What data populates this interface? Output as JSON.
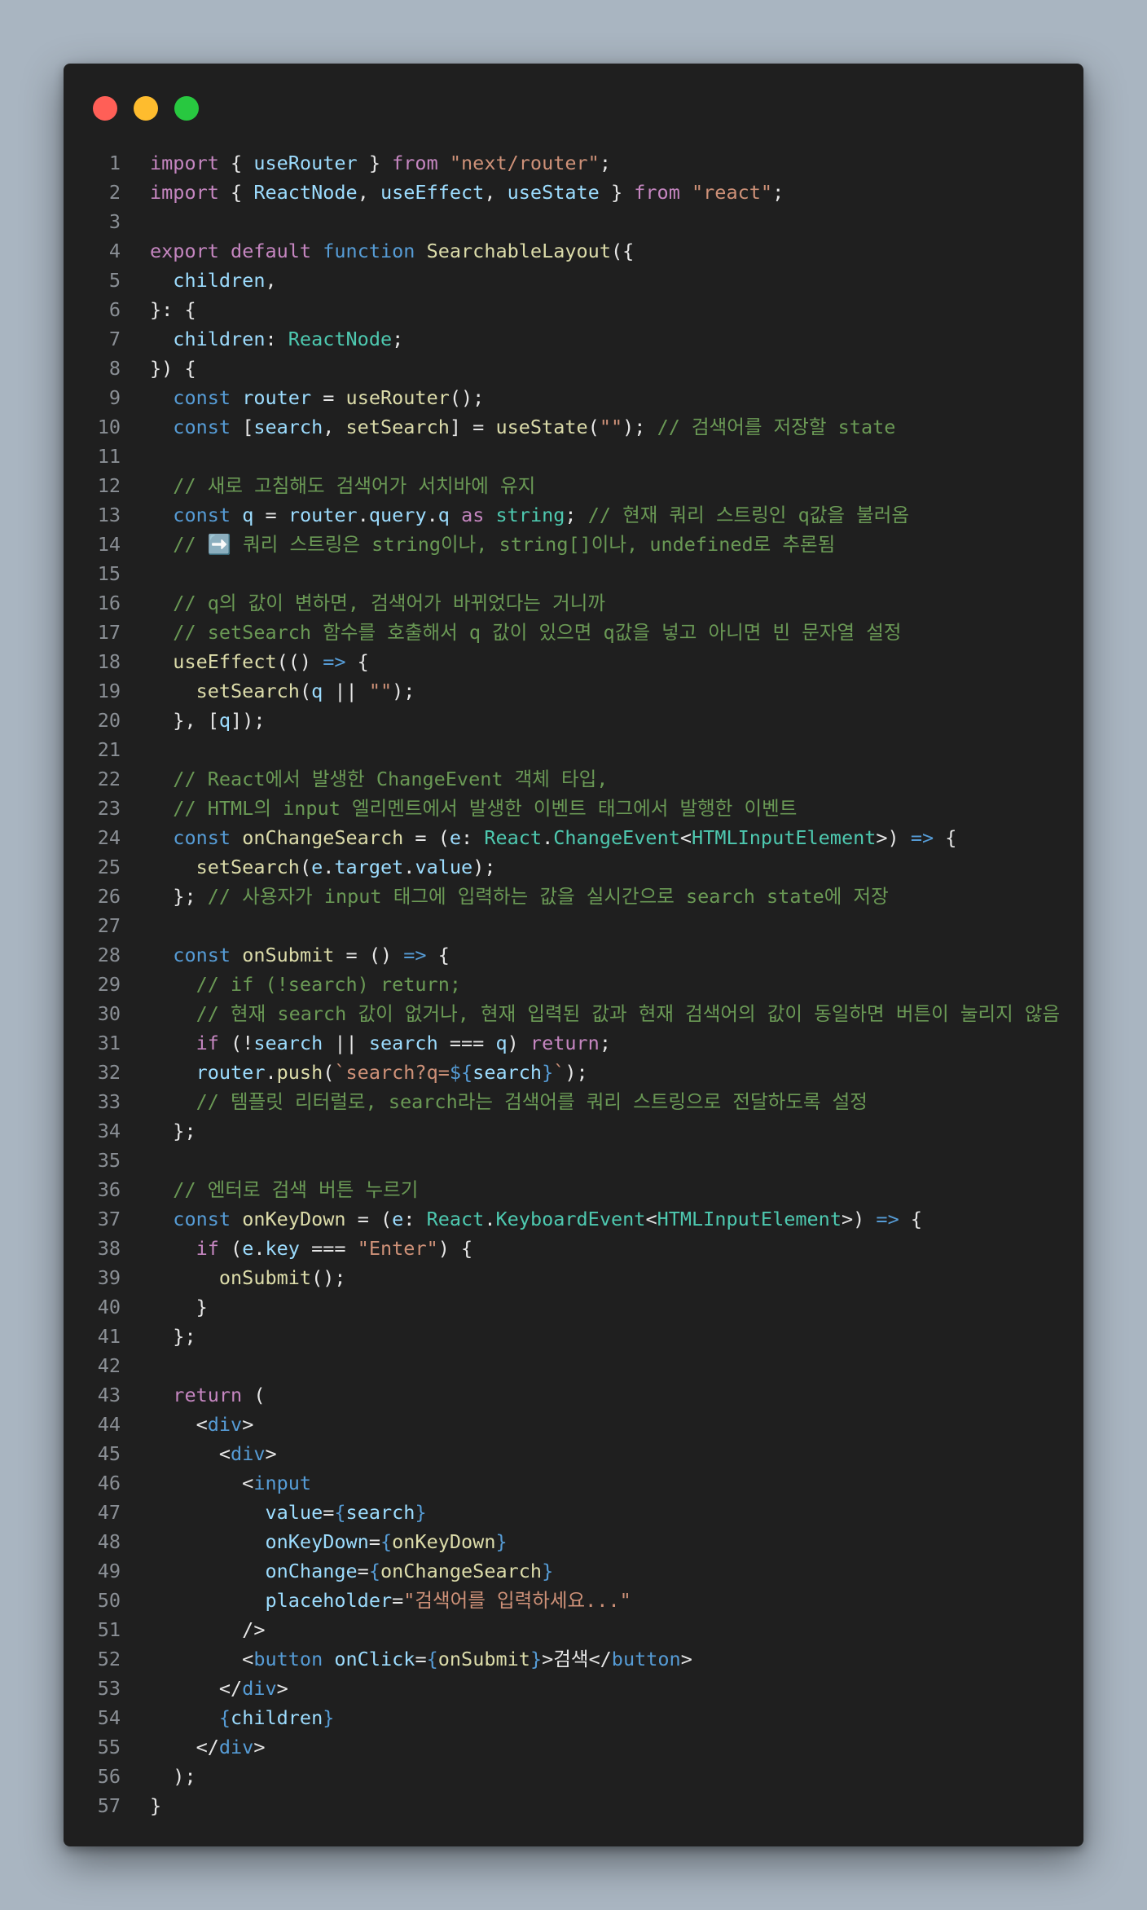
{
  "window": {
    "buttons": [
      {
        "name": "close-button",
        "color": "#ff5f57"
      },
      {
        "name": "minimize-button",
        "color": "#febc2e"
      },
      {
        "name": "zoom-button",
        "color": "#28c840"
      }
    ]
  },
  "code": {
    "lines": [
      {
        "n": "1",
        "t": [
          [
            "kw",
            "import"
          ],
          [
            "p",
            " { "
          ],
          [
            "var",
            "useRouter"
          ],
          [
            "p",
            " } "
          ],
          [
            "kw",
            "from"
          ],
          [
            "p",
            " "
          ],
          [
            "str",
            "\"next/router\""
          ],
          [
            "p",
            ";"
          ]
        ]
      },
      {
        "n": "2",
        "t": [
          [
            "kw",
            "import"
          ],
          [
            "p",
            " { "
          ],
          [
            "var",
            "ReactNode"
          ],
          [
            "p",
            ", "
          ],
          [
            "var",
            "useEffect"
          ],
          [
            "p",
            ", "
          ],
          [
            "var",
            "useState"
          ],
          [
            "p",
            " } "
          ],
          [
            "kw",
            "from"
          ],
          [
            "p",
            " "
          ],
          [
            "str",
            "\"react\""
          ],
          [
            "p",
            ";"
          ]
        ]
      },
      {
        "n": "3",
        "t": []
      },
      {
        "n": "4",
        "t": [
          [
            "kw",
            "export"
          ],
          [
            "p",
            " "
          ],
          [
            "kw",
            "default"
          ],
          [
            "p",
            " "
          ],
          [
            "stor",
            "function"
          ],
          [
            "p",
            " "
          ],
          [
            "fn",
            "SearchableLayout"
          ],
          [
            "p",
            "({"
          ]
        ]
      },
      {
        "n": "5",
        "t": [
          [
            "p",
            "  "
          ],
          [
            "var",
            "children"
          ],
          [
            "p",
            ","
          ]
        ]
      },
      {
        "n": "6",
        "t": [
          [
            "p",
            "}: {"
          ]
        ]
      },
      {
        "n": "7",
        "t": [
          [
            "p",
            "  "
          ],
          [
            "var",
            "children"
          ],
          [
            "p",
            ": "
          ],
          [
            "type",
            "ReactNode"
          ],
          [
            "p",
            ";"
          ]
        ]
      },
      {
        "n": "8",
        "t": [
          [
            "p",
            "}) {"
          ]
        ]
      },
      {
        "n": "9",
        "t": [
          [
            "p",
            "  "
          ],
          [
            "stor",
            "const"
          ],
          [
            "p",
            " "
          ],
          [
            "var",
            "router"
          ],
          [
            "p",
            " = "
          ],
          [
            "fn",
            "useRouter"
          ],
          [
            "p",
            "();"
          ]
        ]
      },
      {
        "n": "10",
        "t": [
          [
            "p",
            "  "
          ],
          [
            "stor",
            "const"
          ],
          [
            "p",
            " ["
          ],
          [
            "var",
            "search"
          ],
          [
            "p",
            ", "
          ],
          [
            "fn",
            "setSearch"
          ],
          [
            "p",
            "] = "
          ],
          [
            "fn",
            "useState"
          ],
          [
            "p",
            "("
          ],
          [
            "str",
            "\"\""
          ],
          [
            "p",
            "); "
          ],
          [
            "cm",
            "// 검색어를 저장할 state"
          ]
        ]
      },
      {
        "n": "11",
        "t": []
      },
      {
        "n": "12",
        "t": [
          [
            "p",
            "  "
          ],
          [
            "cm",
            "// 새로 고침해도 검색어가 서치바에 유지"
          ]
        ]
      },
      {
        "n": "13",
        "t": [
          [
            "p",
            "  "
          ],
          [
            "stor",
            "const"
          ],
          [
            "p",
            " "
          ],
          [
            "var",
            "q"
          ],
          [
            "p",
            " = "
          ],
          [
            "var",
            "router"
          ],
          [
            "p",
            "."
          ],
          [
            "var",
            "query"
          ],
          [
            "p",
            "."
          ],
          [
            "var",
            "q"
          ],
          [
            "p",
            " "
          ],
          [
            "kw",
            "as"
          ],
          [
            "p",
            " "
          ],
          [
            "type",
            "string"
          ],
          [
            "p",
            "; "
          ],
          [
            "cm",
            "// 현재 쿼리 스트링인 q값을 불러옴"
          ]
        ]
      },
      {
        "n": "14",
        "t": [
          [
            "p",
            "  "
          ],
          [
            "cm",
            "// ➡️ 쿼리 스트링은 string이나, string[]이나, undefined로 추론됨"
          ]
        ]
      },
      {
        "n": "15",
        "t": []
      },
      {
        "n": "16",
        "t": [
          [
            "p",
            "  "
          ],
          [
            "cm",
            "// q의 값이 변하면, 검색어가 바뀌었다는 거니까"
          ]
        ]
      },
      {
        "n": "17",
        "t": [
          [
            "p",
            "  "
          ],
          [
            "cm",
            "// setSearch 함수를 호출해서 q 값이 있으면 q값을 넣고 아니면 빈 문자열 설정"
          ]
        ]
      },
      {
        "n": "18",
        "t": [
          [
            "p",
            "  "
          ],
          [
            "fn",
            "useEffect"
          ],
          [
            "p",
            "(() "
          ],
          [
            "stor",
            "=>"
          ],
          [
            "p",
            " {"
          ]
        ]
      },
      {
        "n": "19",
        "t": [
          [
            "p",
            "    "
          ],
          [
            "fn",
            "setSearch"
          ],
          [
            "p",
            "("
          ],
          [
            "var",
            "q"
          ],
          [
            "p",
            " || "
          ],
          [
            "str",
            "\"\""
          ],
          [
            "p",
            ");"
          ]
        ]
      },
      {
        "n": "20",
        "t": [
          [
            "p",
            "  }, ["
          ],
          [
            "var",
            "q"
          ],
          [
            "p",
            "]);"
          ]
        ]
      },
      {
        "n": "21",
        "t": []
      },
      {
        "n": "22",
        "t": [
          [
            "p",
            "  "
          ],
          [
            "cm",
            "// React에서 발생한 ChangeEvent 객체 타입,"
          ]
        ]
      },
      {
        "n": "23",
        "t": [
          [
            "p",
            "  "
          ],
          [
            "cm",
            "// HTML의 input 엘리멘트에서 발생한 이벤트 태그에서 발행한 이벤트"
          ]
        ]
      },
      {
        "n": "24",
        "t": [
          [
            "p",
            "  "
          ],
          [
            "stor",
            "const"
          ],
          [
            "p",
            " "
          ],
          [
            "fn",
            "onChangeSearch"
          ],
          [
            "p",
            " = ("
          ],
          [
            "var",
            "e"
          ],
          [
            "p",
            ": "
          ],
          [
            "type",
            "React"
          ],
          [
            "p",
            "."
          ],
          [
            "type",
            "ChangeEvent"
          ],
          [
            "p",
            "<"
          ],
          [
            "type",
            "HTMLInputElement"
          ],
          [
            "p",
            ">) "
          ],
          [
            "stor",
            "=>"
          ],
          [
            "p",
            " {"
          ]
        ]
      },
      {
        "n": "25",
        "t": [
          [
            "p",
            "    "
          ],
          [
            "fn",
            "setSearch"
          ],
          [
            "p",
            "("
          ],
          [
            "var",
            "e"
          ],
          [
            "p",
            "."
          ],
          [
            "var",
            "target"
          ],
          [
            "p",
            "."
          ],
          [
            "var",
            "value"
          ],
          [
            "p",
            ");"
          ]
        ]
      },
      {
        "n": "26",
        "t": [
          [
            "p",
            "  }; "
          ],
          [
            "cm",
            "// 사용자가 input 태그에 입력하는 값을 실시간으로 search state에 저장"
          ]
        ]
      },
      {
        "n": "27",
        "t": []
      },
      {
        "n": "28",
        "t": [
          [
            "p",
            "  "
          ],
          [
            "stor",
            "const"
          ],
          [
            "p",
            " "
          ],
          [
            "fn",
            "onSubmit"
          ],
          [
            "p",
            " = () "
          ],
          [
            "stor",
            "=>"
          ],
          [
            "p",
            " {"
          ]
        ]
      },
      {
        "n": "29",
        "t": [
          [
            "p",
            "    "
          ],
          [
            "cm",
            "// if (!search) return;"
          ]
        ]
      },
      {
        "n": "30",
        "t": [
          [
            "p",
            "    "
          ],
          [
            "cm",
            "// 현재 search 값이 없거나, 현재 입력된 값과 현재 검색어의 값이 동일하면 버튼이 눌리지 않음"
          ]
        ]
      },
      {
        "n": "31",
        "t": [
          [
            "p",
            "    "
          ],
          [
            "kw",
            "if"
          ],
          [
            "p",
            " (!"
          ],
          [
            "var",
            "search"
          ],
          [
            "p",
            " || "
          ],
          [
            "var",
            "search"
          ],
          [
            "p",
            " === "
          ],
          [
            "var",
            "q"
          ],
          [
            "p",
            ") "
          ],
          [
            "kw",
            "return"
          ],
          [
            "p",
            ";"
          ]
        ]
      },
      {
        "n": "32",
        "t": [
          [
            "p",
            "    "
          ],
          [
            "var",
            "router"
          ],
          [
            "p",
            "."
          ],
          [
            "fn",
            "push"
          ],
          [
            "p",
            "("
          ],
          [
            "str",
            "`search?q="
          ],
          [
            "stor",
            "${"
          ],
          [
            "var",
            "search"
          ],
          [
            "stor",
            "}"
          ],
          [
            "str",
            "`"
          ],
          [
            "p",
            ");"
          ]
        ]
      },
      {
        "n": "33",
        "t": [
          [
            "p",
            "    "
          ],
          [
            "cm",
            "// 템플릿 리터럴로, search라는 검색어를 쿼리 스트링으로 전달하도록 설정"
          ]
        ]
      },
      {
        "n": "34",
        "t": [
          [
            "p",
            "  };"
          ]
        ]
      },
      {
        "n": "35",
        "t": []
      },
      {
        "n": "36",
        "t": [
          [
            "p",
            "  "
          ],
          [
            "cm",
            "// 엔터로 검색 버튼 누르기"
          ]
        ]
      },
      {
        "n": "37",
        "t": [
          [
            "p",
            "  "
          ],
          [
            "stor",
            "const"
          ],
          [
            "p",
            " "
          ],
          [
            "fn",
            "onKeyDown"
          ],
          [
            "p",
            " = ("
          ],
          [
            "var",
            "e"
          ],
          [
            "p",
            ": "
          ],
          [
            "type",
            "React"
          ],
          [
            "p",
            "."
          ],
          [
            "type",
            "KeyboardEvent"
          ],
          [
            "p",
            "<"
          ],
          [
            "type",
            "HTMLInputElement"
          ],
          [
            "p",
            ">) "
          ],
          [
            "stor",
            "=>"
          ],
          [
            "p",
            " {"
          ]
        ]
      },
      {
        "n": "38",
        "t": [
          [
            "p",
            "    "
          ],
          [
            "kw",
            "if"
          ],
          [
            "p",
            " ("
          ],
          [
            "var",
            "e"
          ],
          [
            "p",
            "."
          ],
          [
            "var",
            "key"
          ],
          [
            "p",
            " === "
          ],
          [
            "str",
            "\"Enter\""
          ],
          [
            "p",
            ") {"
          ]
        ]
      },
      {
        "n": "39",
        "t": [
          [
            "p",
            "      "
          ],
          [
            "fn",
            "onSubmit"
          ],
          [
            "p",
            "();"
          ]
        ]
      },
      {
        "n": "40",
        "t": [
          [
            "p",
            "    }"
          ]
        ]
      },
      {
        "n": "41",
        "t": [
          [
            "p",
            "  };"
          ]
        ]
      },
      {
        "n": "42",
        "t": []
      },
      {
        "n": "43",
        "t": [
          [
            "p",
            "  "
          ],
          [
            "kw",
            "return"
          ],
          [
            "p",
            " ("
          ]
        ]
      },
      {
        "n": "44",
        "t": [
          [
            "p",
            "    <"
          ],
          [
            "tag",
            "div"
          ],
          [
            "p",
            ">"
          ]
        ]
      },
      {
        "n": "45",
        "t": [
          [
            "p",
            "      <"
          ],
          [
            "tag",
            "div"
          ],
          [
            "p",
            ">"
          ]
        ]
      },
      {
        "n": "46",
        "t": [
          [
            "p",
            "        <"
          ],
          [
            "tag",
            "input"
          ]
        ]
      },
      {
        "n": "47",
        "t": [
          [
            "p",
            "          "
          ],
          [
            "attr",
            "value"
          ],
          [
            "p",
            "="
          ],
          [
            "brace",
            "{"
          ],
          [
            "var",
            "search"
          ],
          [
            "brace",
            "}"
          ]
        ]
      },
      {
        "n": "48",
        "t": [
          [
            "p",
            "          "
          ],
          [
            "attr",
            "onKeyDown"
          ],
          [
            "p",
            "="
          ],
          [
            "brace",
            "{"
          ],
          [
            "fn",
            "onKeyDown"
          ],
          [
            "brace",
            "}"
          ]
        ]
      },
      {
        "n": "49",
        "t": [
          [
            "p",
            "          "
          ],
          [
            "attr",
            "onChange"
          ],
          [
            "p",
            "="
          ],
          [
            "brace",
            "{"
          ],
          [
            "fn",
            "onChangeSearch"
          ],
          [
            "brace",
            "}"
          ]
        ]
      },
      {
        "n": "50",
        "t": [
          [
            "p",
            "          "
          ],
          [
            "attr",
            "placeholder"
          ],
          [
            "p",
            "="
          ],
          [
            "str",
            "\"검색어를 입력하세요...\""
          ]
        ]
      },
      {
        "n": "51",
        "t": [
          [
            "p",
            "        />"
          ]
        ]
      },
      {
        "n": "52",
        "t": [
          [
            "p",
            "        <"
          ],
          [
            "tag",
            "button"
          ],
          [
            "p",
            " "
          ],
          [
            "attr",
            "onClick"
          ],
          [
            "p",
            "="
          ],
          [
            "brace",
            "{"
          ],
          [
            "fn",
            "onSubmit"
          ],
          [
            "brace",
            "}"
          ],
          [
            "p",
            ">"
          ],
          [
            "text",
            "검색"
          ],
          [
            "p",
            "</"
          ],
          [
            "tag",
            "button"
          ],
          [
            "p",
            ">"
          ]
        ]
      },
      {
        "n": "53",
        "t": [
          [
            "p",
            "      </"
          ],
          [
            "tag",
            "div"
          ],
          [
            "p",
            ">"
          ]
        ]
      },
      {
        "n": "54",
        "t": [
          [
            "p",
            "      "
          ],
          [
            "brace",
            "{"
          ],
          [
            "var",
            "children"
          ],
          [
            "brace",
            "}"
          ]
        ]
      },
      {
        "n": "55",
        "t": [
          [
            "p",
            "    </"
          ],
          [
            "tag",
            "div"
          ],
          [
            "p",
            ">"
          ]
        ]
      },
      {
        "n": "56",
        "t": [
          [
            "p",
            "  );"
          ]
        ]
      },
      {
        "n": "57",
        "t": [
          [
            "p",
            "}"
          ]
        ]
      }
    ]
  }
}
